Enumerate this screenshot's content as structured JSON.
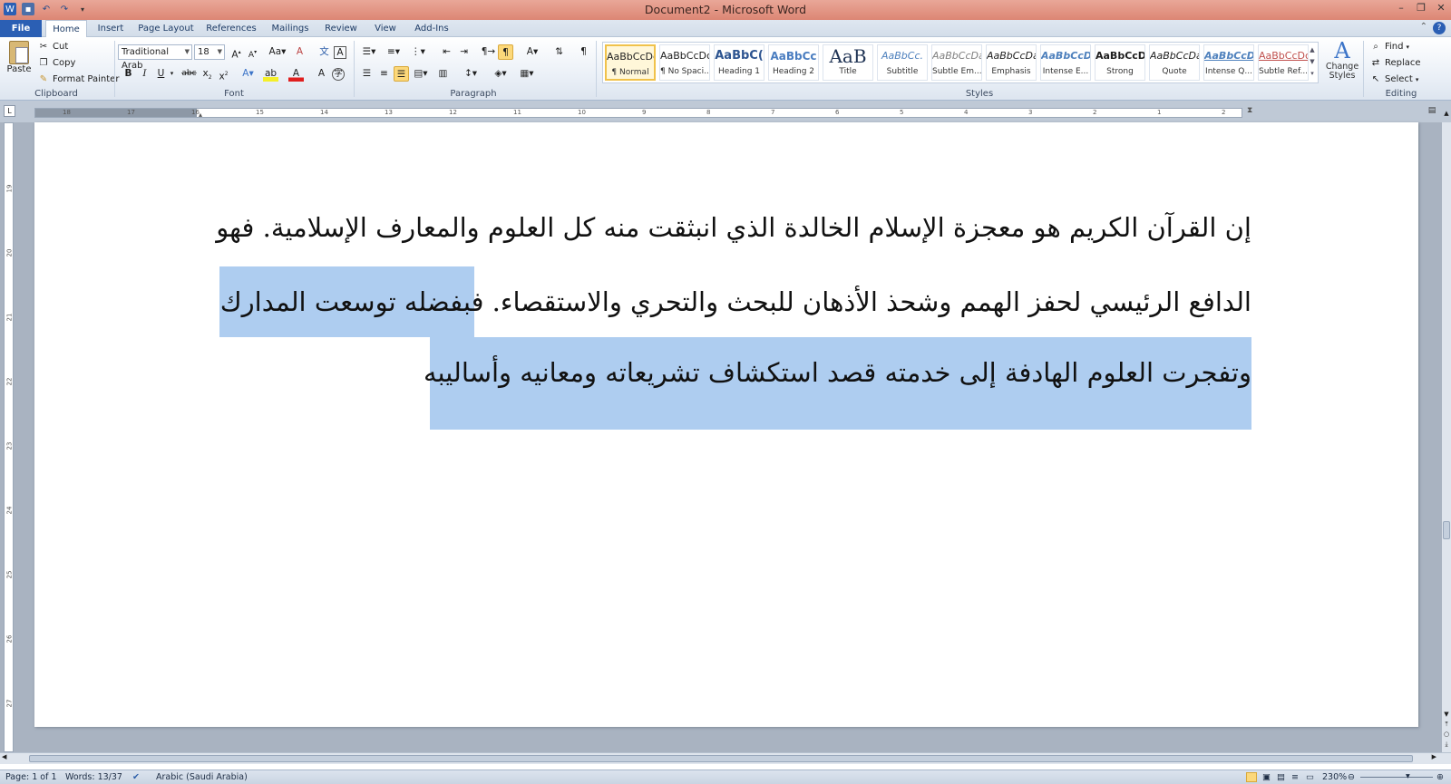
{
  "window": {
    "title": "Document2 - Microsoft Word"
  },
  "tabs": [
    "File",
    "Home",
    "Insert",
    "Page Layout",
    "References",
    "Mailings",
    "Review",
    "View",
    "Add-Ins"
  ],
  "clipboard": {
    "paste": "Paste",
    "cut": "Cut",
    "copy": "Copy",
    "format_painter": "Format Painter",
    "label": "Clipboard"
  },
  "font": {
    "name": "Traditional Arab",
    "size": "18",
    "label": "Font"
  },
  "paragraph": {
    "label": "Paragraph"
  },
  "styles": {
    "label": "Styles",
    "items": [
      {
        "preview": "AaBbCcDc",
        "name": "¶ Normal"
      },
      {
        "preview": "AaBbCcDc",
        "name": "¶ No Spaci..."
      },
      {
        "preview": "AaBbC(",
        "name": "Heading 1"
      },
      {
        "preview": "AaBbCc",
        "name": "Heading 2"
      },
      {
        "preview": "AaB",
        "name": "Title"
      },
      {
        "preview": "AaBbCc.",
        "name": "Subtitle"
      },
      {
        "preview": "AaBbCcDa",
        "name": "Subtle Em..."
      },
      {
        "preview": "AaBbCcDa",
        "name": "Emphasis"
      },
      {
        "preview": "AaBbCcDa",
        "name": "Intense E..."
      },
      {
        "preview": "AaBbCcDc",
        "name": "Strong"
      },
      {
        "preview": "AaBbCcDa",
        "name": "Quote"
      },
      {
        "preview": "AaBbCcDa",
        "name": "Intense Q..."
      },
      {
        "preview": "AaBbCcDc",
        "name": "Subtle Ref..."
      }
    ],
    "change_styles": "Change Styles"
  },
  "editing": {
    "find": "Find",
    "replace": "Replace",
    "select": "Select",
    "label": "Editing"
  },
  "ruler_numbers": [
    "18",
    "17",
    "16",
    "15",
    "14",
    "13",
    "12",
    "11",
    "10",
    "9",
    "8",
    "7",
    "6",
    "5",
    "4",
    "3",
    "2",
    "1",
    "2"
  ],
  "vruler_numbers": [
    "19",
    "20",
    "21",
    "22",
    "23",
    "24",
    "25",
    "26",
    "27"
  ],
  "document": {
    "line1": "إن القرآن الكريم هو معجزة الإسلام الخالدة الذي انبثقت منه كل العلوم والمعارف الإسلامية. فهو",
    "line2_plain": "الدافع الرئيسي لحفز الهمم وشحذ الأذهان للبحث والتحري والاستقصاء. ",
    "line2_selected": "فبفضله توسعت المدارك",
    "line3": "وتفجرت العلوم الهادفة إلى خدمته قصد استكشاف تشريعاته ومعانيه وأساليبه"
  },
  "status": {
    "page": "Page: 1 of 1",
    "words": "Words: 13/37",
    "language": "Arabic (Saudi Arabia)",
    "zoom": "230%"
  },
  "colors": {
    "selection": "#aecdf0",
    "titlebar": "#dc8674",
    "file_tab": "#2b5fb4"
  }
}
